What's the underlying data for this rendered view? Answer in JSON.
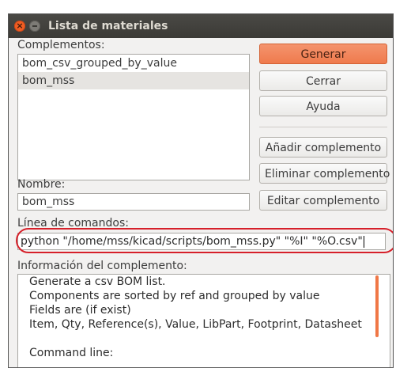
{
  "window": {
    "title": "Lista de materiales",
    "close_glyph": "×"
  },
  "plugins": {
    "label": "Complementos:",
    "items": [
      "bom_csv_grouped_by_value",
      "bom_mss"
    ],
    "selected_index": 1
  },
  "buttons": {
    "generate": "Generar",
    "close": "Cerrar",
    "help": "Ayuda",
    "add_plugin": "Añadir complemento",
    "remove_plugin": "Eliminar complemento",
    "edit_plugin": "Editar complemento"
  },
  "name": {
    "label": "Nombre:",
    "value": "bom_mss"
  },
  "command_line": {
    "label": "Línea de comandos:",
    "value": "python \"/home/mss/kicad/scripts/bom_mss.py\" \"%I\" \"%O.csv\""
  },
  "plugin_info": {
    "label": "Información del complemento:",
    "lines": [
      "Generate a csv BOM list.",
      "Components are sorted by ref and grouped by value",
      "Fields are (if exist)",
      "Item, Qty, Reference(s), Value, LibPart, Footprint, Datasheet",
      "",
      "Command line:"
    ]
  },
  "colors": {
    "accent": "#ef7a4d",
    "highlight_outline": "#d6202a"
  }
}
